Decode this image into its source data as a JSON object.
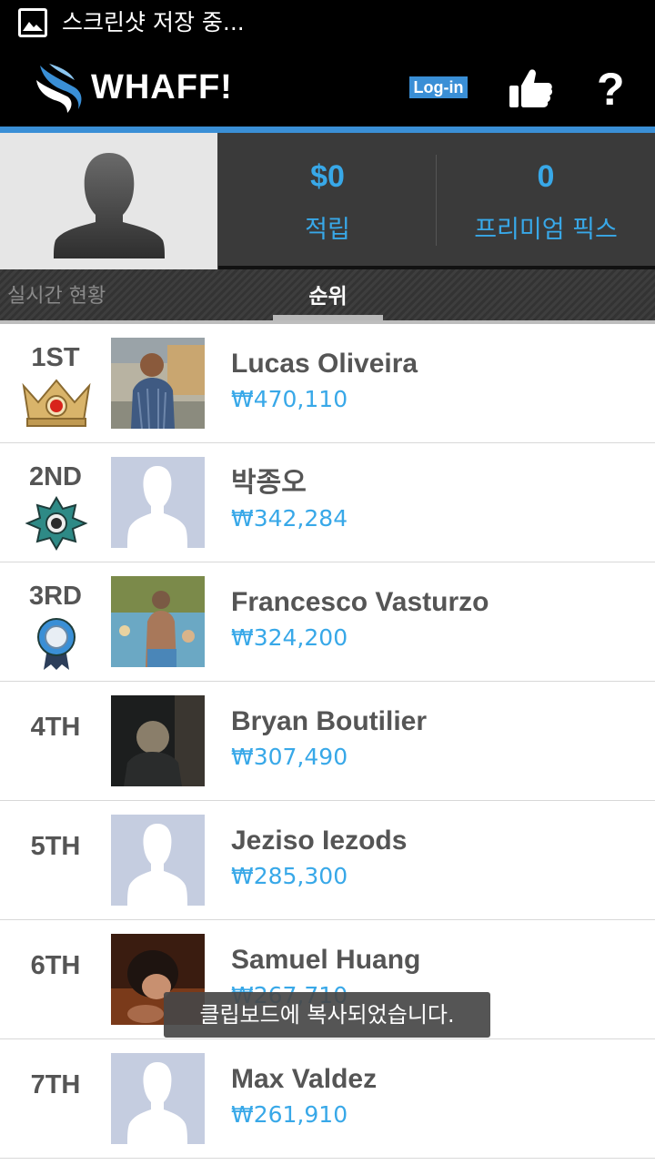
{
  "status_bar": {
    "screenshot_icon": "image-icon",
    "text": "스크린샷 저장 중..."
  },
  "app_bar": {
    "brand": "WHAFF!",
    "login_label": "Log-in",
    "like_icon": "thumbs-up-icon",
    "help_label": "?",
    "colors": {
      "background": "#000000",
      "accent": "#3a8fd6"
    }
  },
  "profile": {
    "avatar_icon": "default-user-silhouette",
    "balance_value": "$0",
    "balance_label": "적립",
    "premium_value": "0",
    "premium_label": "프리미엄 픽스",
    "colors": {
      "value": "#38a8e8"
    }
  },
  "tabs": {
    "items": [
      {
        "label": "실시간 현황",
        "selected": false
      },
      {
        "label": "순위",
        "selected": true
      }
    ]
  },
  "ranking": {
    "rows": [
      {
        "rank": "1ST",
        "badge": "gold-crown-badge",
        "photo": "photo",
        "name": "Lucas Oliveira",
        "amount": "₩470,110"
      },
      {
        "rank": "2ND",
        "badge": "teal-star-badge",
        "photo": "default-avatar",
        "name": "박종오",
        "amount": "₩342,284"
      },
      {
        "rank": "3RD",
        "badge": "blue-ribbon-badge",
        "photo": "photo",
        "name": "Francesco Vasturzo",
        "amount": "₩324,200"
      },
      {
        "rank": "4TH",
        "badge": "",
        "photo": "photo",
        "name": "Bryan Boutilier",
        "amount": "₩307,490"
      },
      {
        "rank": "5TH",
        "badge": "",
        "photo": "default-avatar",
        "name": "Jeziso Iezods",
        "amount": "₩285,300"
      },
      {
        "rank": "6TH",
        "badge": "",
        "photo": "photo",
        "name": "Samuel Huang",
        "amount": "₩267,710"
      },
      {
        "rank": "7TH",
        "badge": "",
        "photo": "default-avatar",
        "name": "Max Valdez",
        "amount": "₩261,910"
      }
    ]
  },
  "toast": {
    "text": "클립보드에 복사되었습니다."
  }
}
